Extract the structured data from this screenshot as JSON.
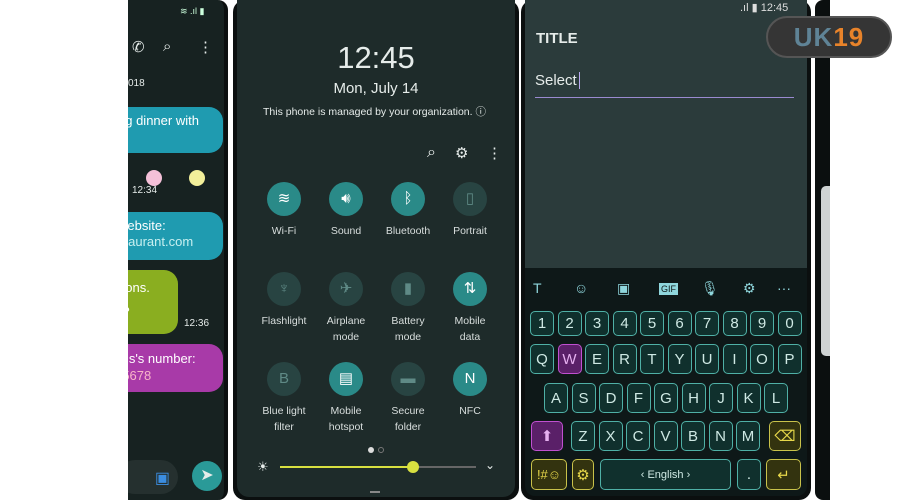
{
  "messages": {
    "date_fragment": "018",
    "bubbles": [
      {
        "text": "ng dinner with",
        "color": "#1f9bb0"
      },
      {
        "text": "website:",
        "text2": "staurant.com",
        "color": "#1f9bb0"
      },
      {
        "text": "pons.",
        "text2": "r?",
        "color": "#8aae20"
      },
      {
        "text": "ms's number:",
        "text2": "-5678",
        "color": "#a83aa8"
      }
    ],
    "times": [
      "12:34",
      "12:36"
    ]
  },
  "quick_panel": {
    "time": "12:45",
    "date": "Mon, July 14",
    "managed_notice": "This phone is managed by your organization.",
    "tiles": [
      {
        "label": "Wi-Fi",
        "icon": "wifi-icon",
        "glyph": "≋",
        "active": true
      },
      {
        "label": "Sound",
        "icon": "sound-icon",
        "glyph": "🔊︎",
        "active": true
      },
      {
        "label": "Bluetooth",
        "icon": "bluetooth-icon",
        "glyph": "ᛒ",
        "active": true
      },
      {
        "label": "Portrait",
        "icon": "portrait-icon",
        "glyph": "▯",
        "active": false
      },
      {
        "label": "Flashlight",
        "icon": "flashlight-icon",
        "glyph": "♆",
        "active": false
      },
      {
        "label": "Airplane\nmode",
        "icon": "airplane-icon",
        "glyph": "✈",
        "active": false
      },
      {
        "label": "Battery\nmode",
        "icon": "battery-icon",
        "glyph": "▮",
        "active": false
      },
      {
        "label": "Mobile\ndata",
        "icon": "mobile-data-icon",
        "glyph": "⇅",
        "active": true
      },
      {
        "label": "Blue light\nfilter",
        "icon": "blue-light-icon",
        "glyph": "B",
        "active": false
      },
      {
        "label": "Mobile\nhotspot",
        "icon": "hotspot-icon",
        "glyph": "▤",
        "active": true
      },
      {
        "label": "Secure\nfolder",
        "icon": "secure-folder-icon",
        "glyph": "▬",
        "active": false
      },
      {
        "label": "NFC",
        "icon": "nfc-icon",
        "glyph": "N",
        "active": true
      }
    ],
    "brightness": 0.68,
    "page": 1,
    "pages": 2
  },
  "editor": {
    "status_time": "12:45",
    "title": "TITLE",
    "input_value": "Select"
  },
  "keyboard": {
    "toolbar": [
      {
        "icon": "translate-icon",
        "glyph": "T"
      },
      {
        "icon": "emoji-icon",
        "glyph": "☺"
      },
      {
        "icon": "sticker-icon",
        "glyph": "▣"
      },
      {
        "icon": "gif-icon",
        "glyph": "GIF"
      },
      {
        "icon": "mic-icon",
        "glyph": "🎙︎"
      },
      {
        "icon": "settings-icon",
        "glyph": "⚙"
      },
      {
        "icon": "more-icon",
        "glyph": "···"
      }
    ],
    "rows": [
      [
        "1",
        "2",
        "3",
        "4",
        "5",
        "6",
        "7",
        "8",
        "9",
        "0"
      ],
      [
        "Q",
        "W",
        "E",
        "R",
        "T",
        "Y",
        "U",
        "I",
        "O",
        "P"
      ],
      [
        "A",
        "S",
        "D",
        "F",
        "G",
        "H",
        "J",
        "K",
        "L"
      ],
      [
        "Z",
        "X",
        "C",
        "V",
        "B",
        "N",
        "M"
      ]
    ],
    "highlighted_key": "W",
    "symbols_label": "!#☺",
    "space_label": "English",
    "period": ".",
    "colors": {
      "key": "#4fb0a6",
      "purple": "#c050d0",
      "yellow": "#c9c24a"
    }
  },
  "watermark": "UK19"
}
